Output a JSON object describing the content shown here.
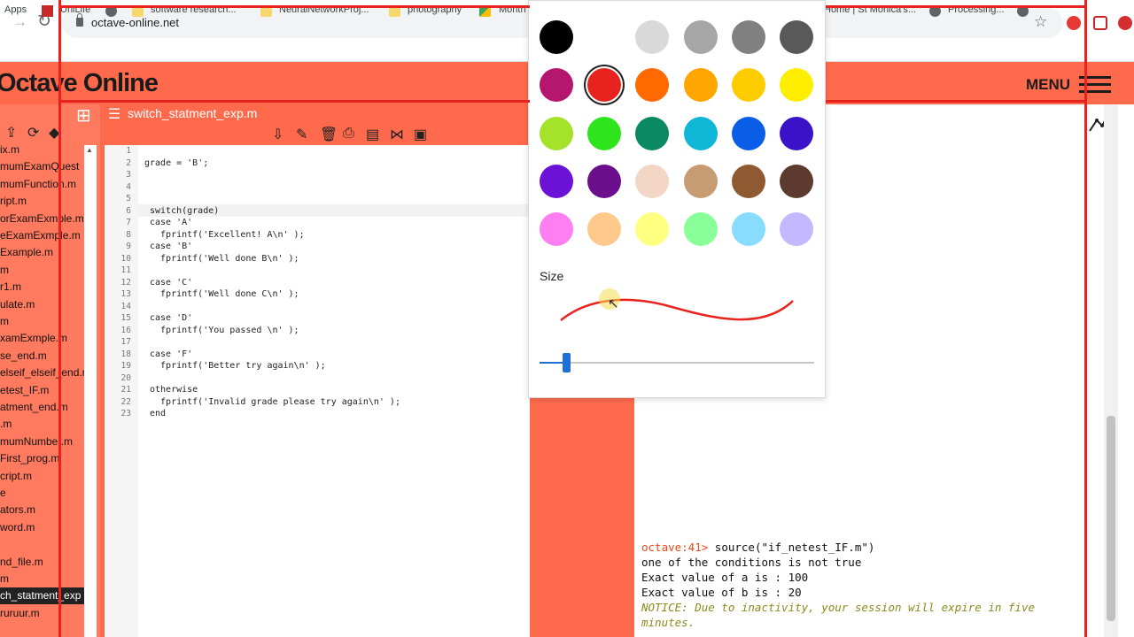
{
  "browser": {
    "url": "octave-online.net",
    "bookmarks": [
      "Apps",
      "UniLife",
      "software research...",
      "NeuralNetworkProj...",
      "photography",
      "Month",
      "Home | St Monica's...",
      "Processing..."
    ]
  },
  "app": {
    "logo": "Octave Online",
    "menu_label": "MENU"
  },
  "sidebar": {
    "files": [
      "ix.m",
      "mumExamQuest",
      "mumFunction.m",
      "ript.m",
      "orExamExmple.m",
      "eExamExmple.m",
      "Example.m",
      "m",
      "r1.m",
      "ulate.m",
      "m",
      "xamExmple.m",
      "se_end.m",
      "elseif_elseif_end.m",
      "etest_IF.m",
      "atment_end.m",
      ".m",
      "mumNumber.m",
      "First_prog.m",
      "cript.m",
      "e",
      "ators.m",
      "word.m",
      "",
      "nd_file.m",
      "m",
      "ch_statment_exp",
      "ruruur.m"
    ],
    "active_index": 26
  },
  "editor": {
    "filename": "switch_statment_exp.m",
    "lines": [
      "",
      "grade = 'B';",
      "",
      "",
      "",
      "switch(grade)",
      "case 'A'",
      "  fprintf('Excellent! A\\n' );",
      "case 'B'",
      "  fprintf('Well done B\\n' );",
      "",
      "case 'C'",
      "  fprintf('Well done C\\n' );",
      "",
      "case 'D'",
      "  fprintf('You passed \\n' );",
      "",
      "case 'F'",
      "  fprintf('Better try again\\n' );",
      "",
      "otherwise",
      "  fprintf('Invalid grade please try again\\n' );",
      "end"
    ]
  },
  "console": {
    "prompt": "octave:41>",
    "command": " source(\"if_netest_IF.m\")",
    "output": [
      "one of the conditions is not true",
      "Exact value of a is : 100",
      "Exact value of b is : 20"
    ],
    "notice_line1": "NOTICE: Due to inactivity, your session will expire in five",
    "notice_line2": "minutes."
  },
  "color_picker": {
    "size_label": "Size",
    "swatches": [
      "#000000",
      "#ffffff",
      "#d9d9d9",
      "#a6a6a6",
      "#808080",
      "#595959",
      "#b5176e",
      "#e8231f",
      "#ff6a00",
      "#ffa500",
      "#ffcc00",
      "#ffee00",
      "#a5e22a",
      "#2ee51d",
      "#0b8a62",
      "#0fb6d6",
      "#0a5de6",
      "#3a12c7",
      "#6b12d6",
      "#6b0f8c",
      "#f3d6c6",
      "#c79c72",
      "#8f5a32",
      "#5c3a2e",
      "#ff7ff2",
      "#ffc98c",
      "#ffff80",
      "#88ff99",
      "#88ddff",
      "#c4b8ff"
    ],
    "selected_index": 7,
    "stroke_color": "#e8231f",
    "size_value": 0.1
  },
  "colors": {
    "brand": "#ff6a4d",
    "annotation": "#e8231f",
    "slider": "#1e6fd9"
  }
}
